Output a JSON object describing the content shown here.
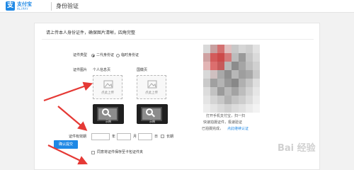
{
  "header": {
    "logo_cn": "支付宝",
    "logo_en": "ALIPAY",
    "title": "身份验证"
  },
  "main": {
    "instruction": "请上传本人身份证件，确保图片清晰，四角完整"
  },
  "form": {
    "doc_type_label": "证件类型",
    "doc_type_options": [
      "二代身份证",
      "临时身份证"
    ],
    "doc_type_selected": "二代身份证",
    "doc_image_label": "证件图片",
    "front_label": "个人信息页",
    "back_label": "国徽页",
    "upload_text": "点此上传",
    "sample_caption": "示例",
    "validity_label": "证件有效期",
    "year_unit": "年",
    "month_unit": "月",
    "day_unit": "日",
    "longterm_label": "长期",
    "save_checkbox_label": "同意将证件保存至卡包证件夹",
    "submit_label": "确认提交"
  },
  "qr_panel": {
    "line1": "打开手机支付宝，扫一扫",
    "line2": "快速拍摄证件，极速验证",
    "prefix": "已拍摄完成，",
    "link": "点此继续认证"
  },
  "watermark": "Bai 经验",
  "colors": {
    "brand_blue": "#1e88e5",
    "arrow_red": "#e53935",
    "link_blue": "#1e88e5"
  }
}
